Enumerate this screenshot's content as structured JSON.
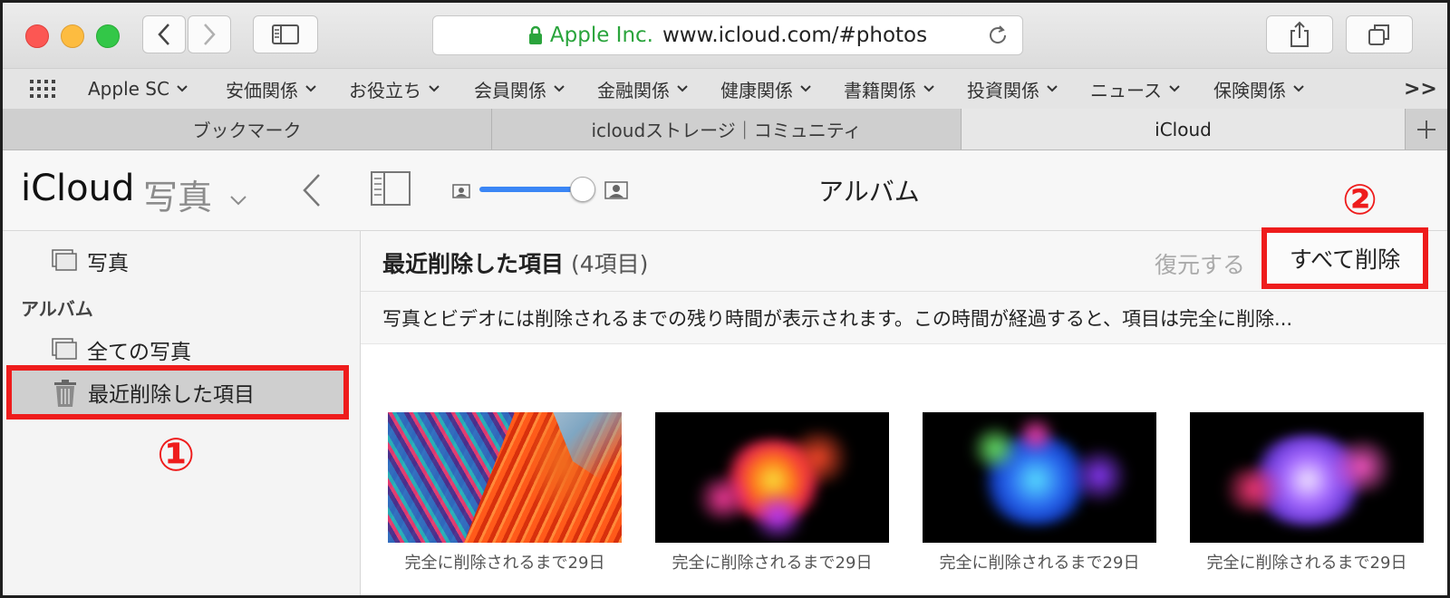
{
  "browser": {
    "address_company": "Apple Inc.",
    "address_url": "www.icloud.com/#photos",
    "favorites": [
      "Apple SC",
      "安価関係",
      "お役立ち",
      "会員関係",
      "金融関係",
      "健康関係",
      "書籍関係",
      "投資関係",
      "ニュース",
      "保険関係"
    ],
    "overflow_label": ">>",
    "tabs": [
      "ブックマーク",
      "icloudストレージ｜コミュニティ",
      "iCloud"
    ],
    "active_tab": 2
  },
  "app": {
    "brand": "iCloud",
    "app_name": "写真",
    "view_title": "アルバム"
  },
  "sidebar": {
    "photos_label": "写真",
    "albums_header": "アルバム",
    "all_photos_label": "全ての写真",
    "recently_deleted_label": "最近削除した項目"
  },
  "main": {
    "title": "最近削除した項目",
    "count": "(4項目)",
    "restore_label": "復元する",
    "delete_all_label": "すべて削除",
    "notice": "写真とビデオには削除されるまでの残り時間が表示されます。この時間が経過すると、項目は完全に削除...",
    "thumbnails": [
      {
        "caption": "完全に削除されるまで29日"
      },
      {
        "caption": "完全に削除されるまで29日"
      },
      {
        "caption": "完全に削除されるまで29日"
      },
      {
        "caption": "完全に削除されるまで29日"
      }
    ]
  },
  "annotations": {
    "step1": "①",
    "step2": "②"
  },
  "colors": {
    "annotation_red": "#ee1c1c",
    "slider_blue": "#3b86f5",
    "lock_green": "#2aa43c"
  }
}
